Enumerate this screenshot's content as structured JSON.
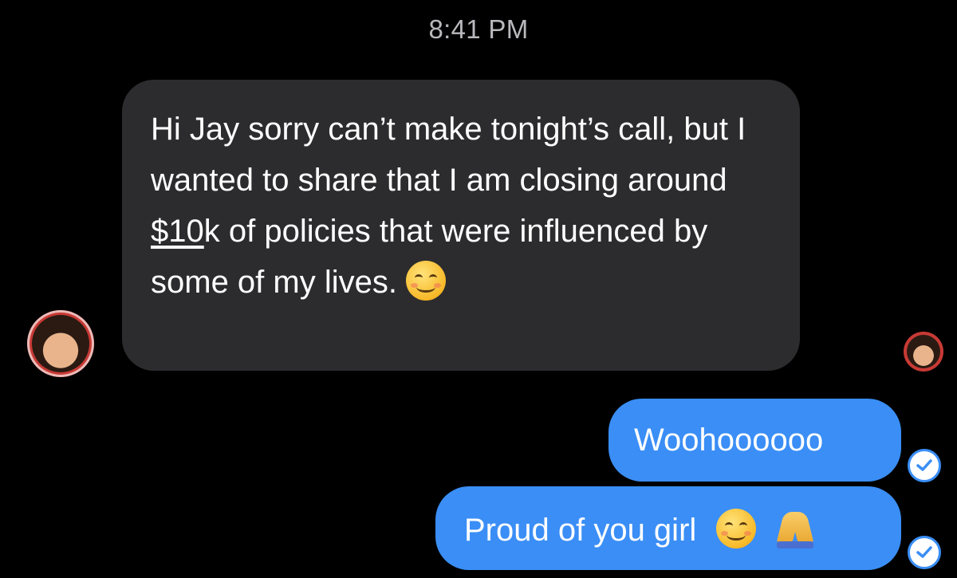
{
  "timestamp": "8:41 PM",
  "incoming_message": {
    "text_before_link": "Hi Jay sorry can’t make tonight’s call, but I wanted to share that I am closing around ",
    "link_text": "$10",
    "text_after_link": "k of policies that were influenced by some of my lives.",
    "emoji": "smiling-face-with-smiling-eyes"
  },
  "outgoing_messages": [
    {
      "text": "Woohoooooo",
      "status": "delivered"
    },
    {
      "text": "Proud of you girl",
      "emojis": [
        "smiling-face",
        "folded-hands"
      ],
      "status": "delivered"
    }
  ],
  "colors": {
    "background": "#000000",
    "incoming_bubble": "#2c2c2e",
    "outgoing_bubble": "#3a8ef6",
    "timestamp": "#b9b9bd",
    "avatar_ring": "#c83a35"
  }
}
